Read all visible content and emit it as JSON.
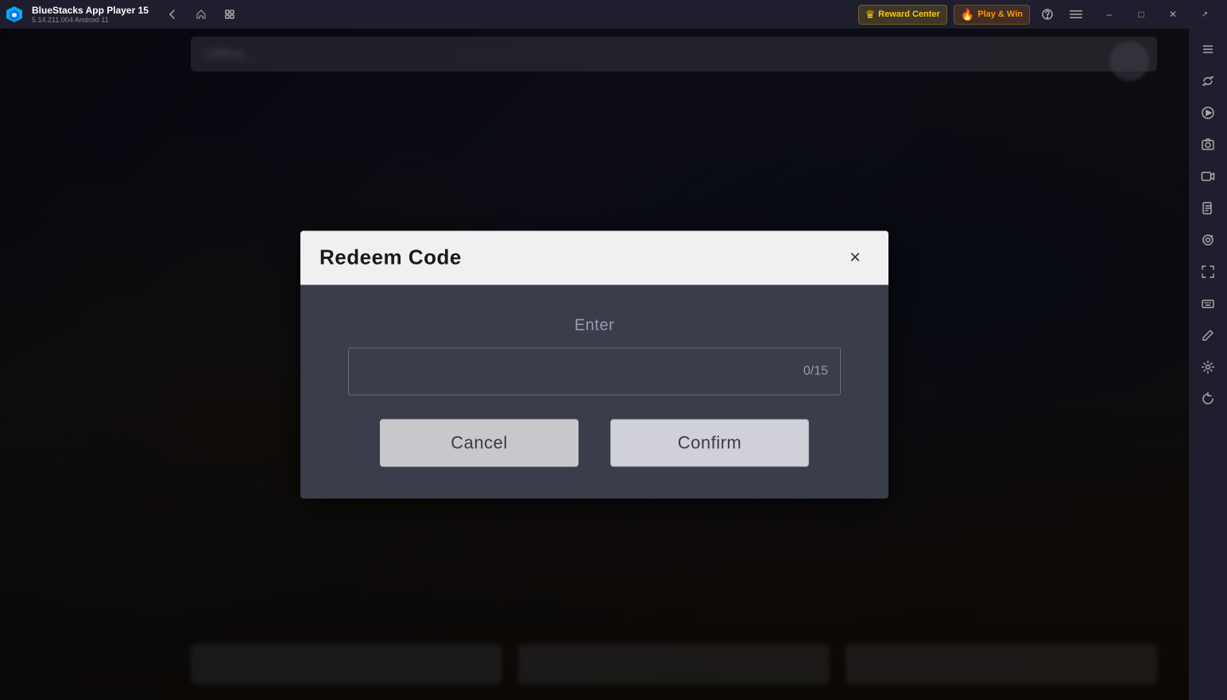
{
  "titlebar": {
    "app_name": "BlueStacks App Player 15",
    "app_version": "5.14.211.004  Android 11",
    "reward_center_label": "Reward Center",
    "play_win_label": "Play & Win"
  },
  "modal": {
    "title": "Redeem Code",
    "enter_label": "Enter",
    "char_counter": "0/15",
    "cancel_label": "Cancel",
    "confirm_label": "Confirm",
    "close_icon": "×"
  },
  "sidebar": {
    "icons": [
      "⊞",
      "↺",
      "▶",
      "⊡",
      "📷",
      "⊟",
      "⊕",
      "✏",
      "⚙",
      "⊘"
    ]
  }
}
